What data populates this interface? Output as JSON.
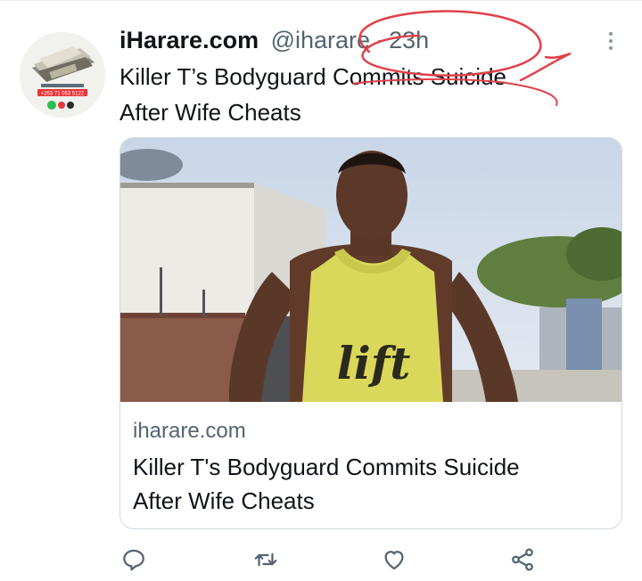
{
  "tweet": {
    "display_name": "iHarare.com",
    "handle": "@iharare",
    "separator": "·",
    "timestamp": "23h",
    "text_line1": "Killer T’s Bodyguard Commits Suicide",
    "text_line2": "After Wife Cheats"
  },
  "avatar": {
    "phone": "+263 71 053 5122"
  },
  "card": {
    "domain": "iharare.com",
    "title_line1": "Killer T's Bodyguard Commits Suicide",
    "title_line2": "After Wife Cheats",
    "shirt_text": "lift"
  },
  "actions": {
    "reply_icon": "reply-icon",
    "retweet_icon": "retweet-icon",
    "like_icon": "heart-icon",
    "share_icon": "share-icon"
  },
  "colors": {
    "text": "#0f1419",
    "secondary": "#536471",
    "border": "#cfd9de",
    "annotation": "#e0414a"
  }
}
